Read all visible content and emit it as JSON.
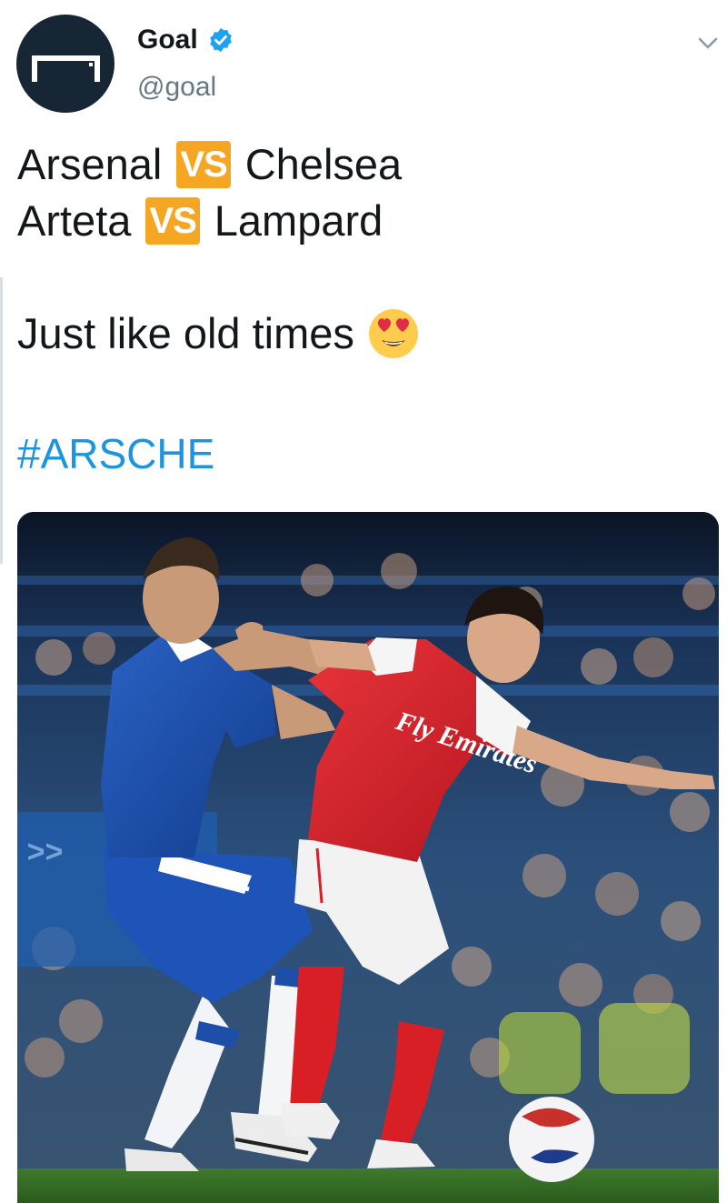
{
  "account": {
    "name": "Goal",
    "handle": "@goal",
    "avatar_icon": "goal-logo-icon",
    "verified_icon": "verified-badge-icon"
  },
  "menu": {
    "icon": "chevron-down-icon"
  },
  "tweet": {
    "line1": {
      "left": "Arsenal",
      "badge": "VS",
      "right": "Chelsea"
    },
    "line2": {
      "left": "Arteta",
      "badge": "VS",
      "right": "Lampard"
    },
    "line3": "Just like old times",
    "emoji": "heart-eyes-emoji",
    "hashtag": "#ARSCHE"
  },
  "media": {
    "description_icon": "match-photo",
    "shirt_text": "Fly Emirates"
  },
  "colors": {
    "brand_dark": "#172634",
    "verified": "#1da1f2",
    "badge": "#f5a623",
    "hashtag": "#1b95e0",
    "handle": "#657786"
  }
}
